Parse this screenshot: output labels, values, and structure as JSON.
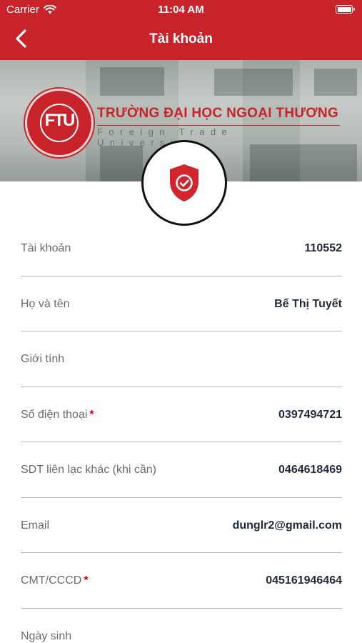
{
  "status_bar": {
    "carrier": "Carrier",
    "time": "11:04 AM"
  },
  "nav": {
    "title": "Tài khoản",
    "back_icon": "chevron-left-icon"
  },
  "banner": {
    "university_name": "TRƯỜNG ĐẠI HỌC NGOẠI THƯƠNG",
    "university_subtitle": "Foreign Trade University",
    "seal_monogram": "FTU",
    "badge_icon": "shield-check-icon"
  },
  "colors": {
    "brand": "#c8222a",
    "required_mark": "#d0021b",
    "label": "#6b6b6b",
    "value": "#1f2a36",
    "divider": "#b8b8b8"
  },
  "fields": [
    {
      "label": "Tài khoản",
      "value": "110552",
      "required": ""
    },
    {
      "label": "Họ và tên",
      "value": "Bế Thị Tuyết",
      "required": ""
    },
    {
      "label": "Giới tính",
      "value": "",
      "required": ""
    },
    {
      "label": "Số điện thoại",
      "value": "0397494721",
      "required": "*"
    },
    {
      "label": "SDT liên lạc khác (khi cần)",
      "value": "0464618469",
      "required": ""
    },
    {
      "label": "Email",
      "value": "dunglr2@gmail.com",
      "required": ""
    },
    {
      "label": "CMT/CCCD",
      "value": "045161946464",
      "required": "*"
    },
    {
      "label": "Ngày sinh",
      "value": "",
      "required": ""
    }
  ]
}
